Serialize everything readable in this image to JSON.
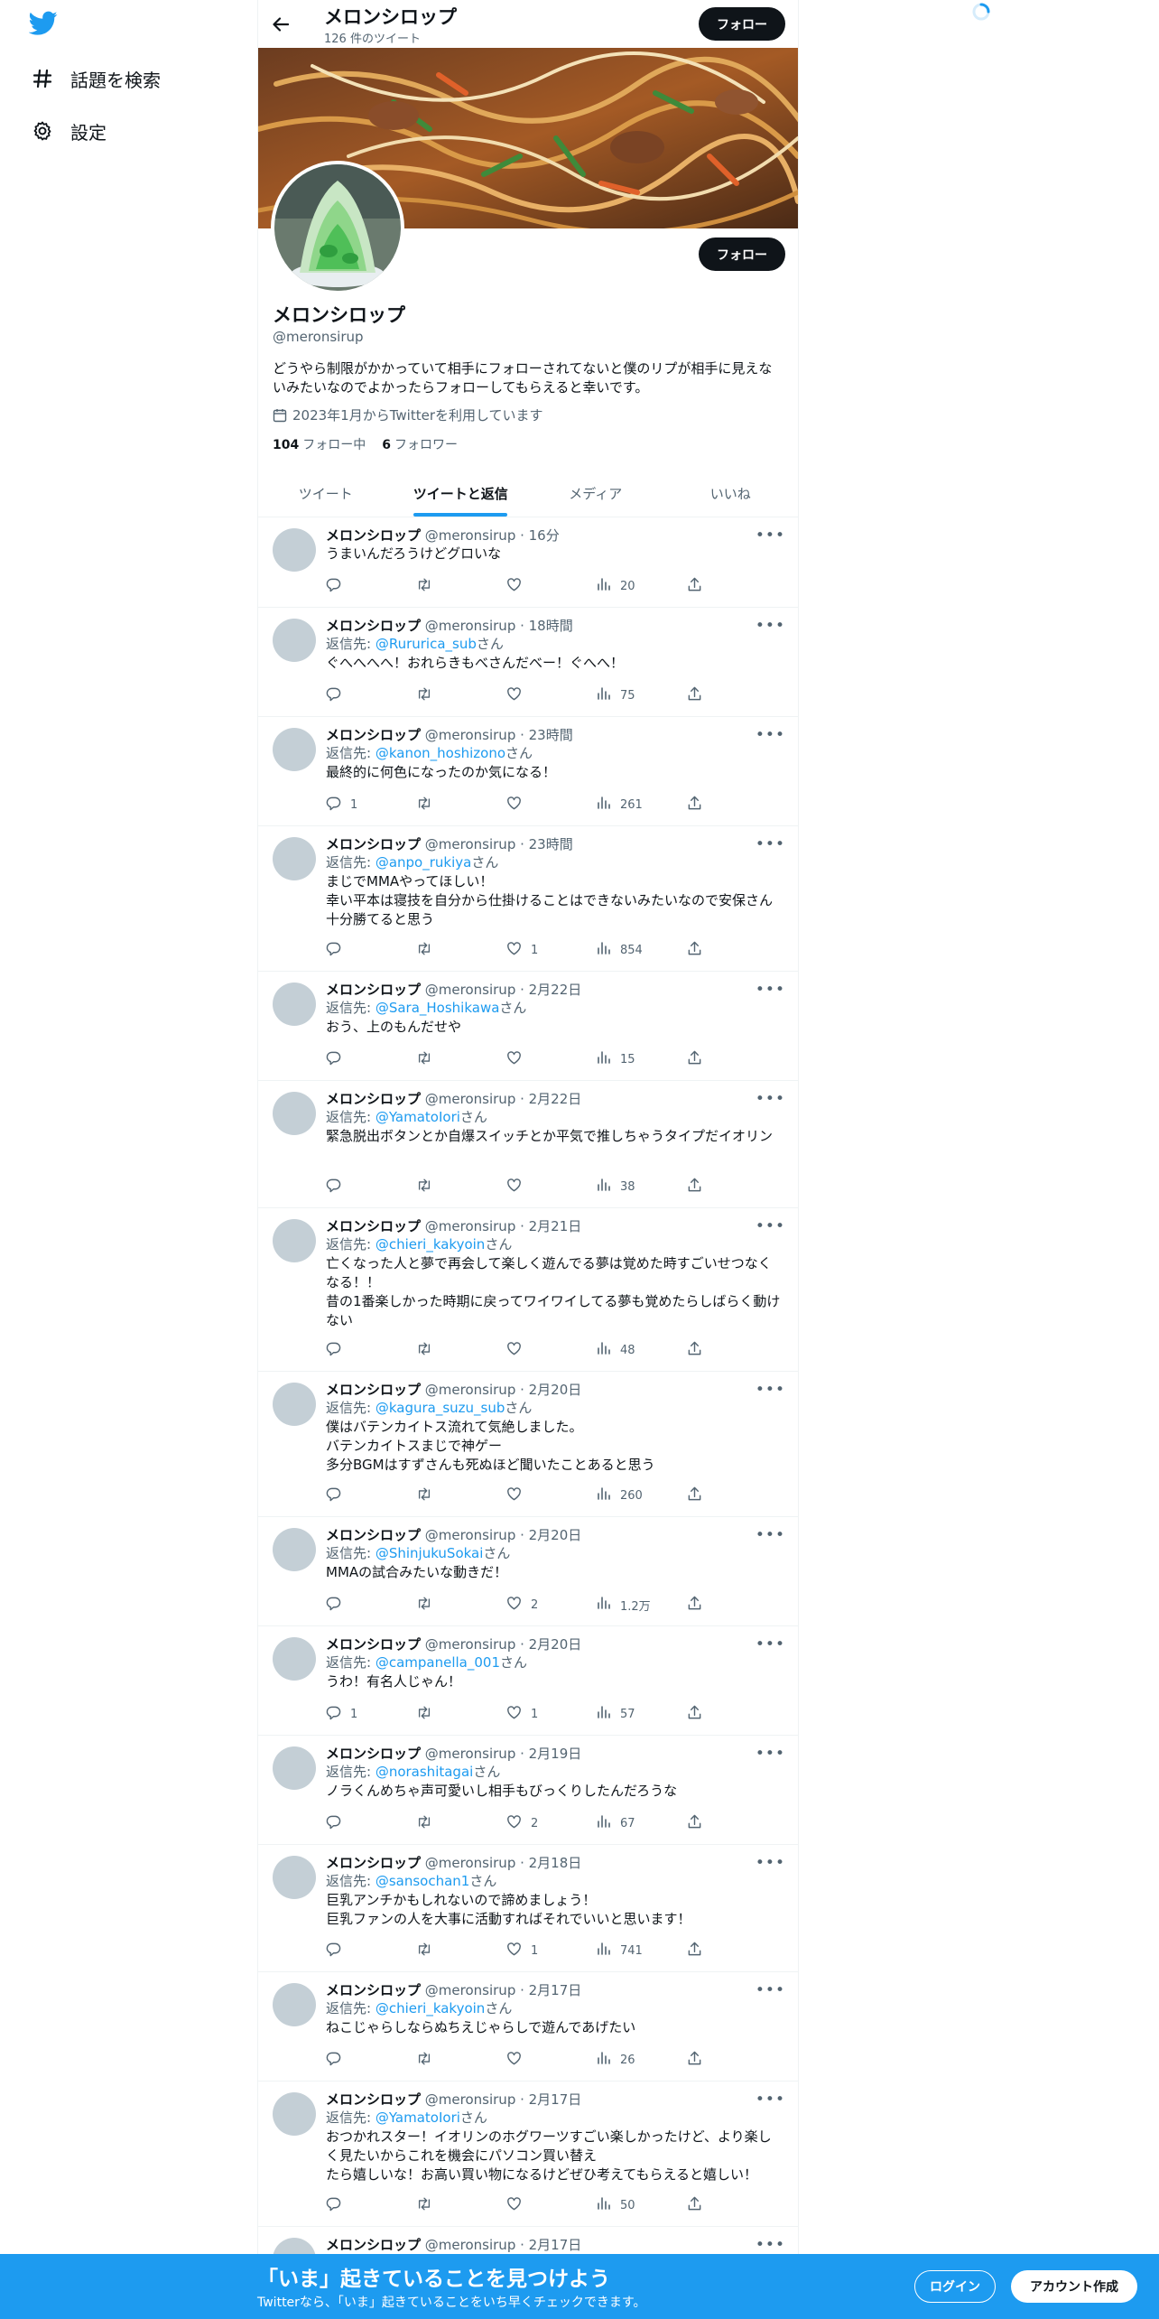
{
  "nav": {
    "explore_label": "話題を検索",
    "settings_label": "設定"
  },
  "header": {
    "name": "メロンシロップ",
    "tweet_count": "126 件のツイート",
    "follow_label": "フォロー"
  },
  "profile": {
    "name": "メロンシロップ",
    "handle": "@meronsirup",
    "bio": "どうやら制限がかかっていて相手にフォローされてないと僕のリプが相手に見えないみたいなのでよかったらフォローしてもらえると幸いです。",
    "joined": "2023年1月からTwitterを利用しています",
    "following_count": "104",
    "following_label": "フォロー中",
    "followers_count": "6",
    "followers_label": "フォロワー",
    "follow_label": "フォロー"
  },
  "tabs": [
    "ツイート",
    "ツイートと返信",
    "メディア",
    "いいね"
  ],
  "active_tab": 1,
  "tweets": [
    {
      "name": "メロンシロップ",
      "meta": "@meronsirup · 16分",
      "reply_to": "",
      "text": "うまいんだろうけどグロいな",
      "replies": "",
      "likes": "",
      "views": "20",
      "height": 100
    },
    {
      "name": "メロンシロップ",
      "meta": "@meronsirup · 18時間",
      "reply_to": "@Rururica_sub",
      "text": "ぐへへへへ！おれらきもべさんだべー！ぐへへ！",
      "replies": "",
      "likes": "",
      "views": "75",
      "height": 121
    },
    {
      "name": "メロンシロップ",
      "meta": "@meronsirup · 23時間",
      "reply_to": "@kanon_hoshizono",
      "text": "最終的に何色になったのか気になる！",
      "replies": "1",
      "likes": "",
      "views": "261",
      "height": 121
    },
    {
      "name": "メロンシロップ",
      "meta": "@meronsirup · 23時間",
      "reply_to": "@anpo_rukiya",
      "text": "まじでMMAやってほしい！\n幸い平本は寝技を自分から仕掛けることはできないみたいなので安保さん十分勝てると思う",
      "replies": "",
      "likes": "1",
      "views": "854",
      "height": 161
    },
    {
      "name": "メロンシロップ",
      "meta": "@meronsirup · 2月22日",
      "reply_to": "@Sara_Hoshikawa",
      "text": "おう、上のもんだせや",
      "replies": "",
      "likes": "",
      "views": "15",
      "height": 121
    },
    {
      "name": "メロンシロップ",
      "meta": "@meronsirup · 2月22日",
      "reply_to": "@YamatoIori",
      "text": "緊急脱出ボタンとか自爆スイッチとか平気で推しちゃうタイプだイオリン",
      "replies": "",
      "likes": "",
      "views": "38",
      "height": 141
    },
    {
      "name": "メロンシロップ",
      "meta": "@meronsirup · 2月21日",
      "reply_to": "@chieri_kakyoin",
      "text": "亡くなった人と夢で再会して楽しく遊んでる夢は覚めた時すごいせつなくなる！！\n昔の1番楽しかった時期に戻ってワイワイしてる夢も覚めたらしばらく動けない",
      "replies": "",
      "likes": "",
      "views": "48",
      "height": 181
    },
    {
      "name": "メロンシロップ",
      "meta": "@meronsirup · 2月20日",
      "reply_to": "@kagura_suzu_sub",
      "text": "僕はバテンカイトス流れて気絶しました。\nバテンカイトスまじで神ゲー\n多分BGMはすずさんも死ぬほど聞いたことあると思う",
      "replies": "",
      "likes": "",
      "views": "260",
      "height": 161
    },
    {
      "name": "メロンシロップ",
      "meta": "@meronsirup · 2月20日",
      "reply_to": "@ShinjukuSokai",
      "text": "MMAの試合みたいな動きだ！",
      "replies": "",
      "likes": "2",
      "views": "1.2万",
      "height": 121
    },
    {
      "name": "メロンシロップ",
      "meta": "@meronsirup · 2月20日",
      "reply_to": "@campanella_001",
      "text": "うわ！有名人じゃん！",
      "replies": "1",
      "likes": "1",
      "views": "57",
      "height": 121
    },
    {
      "name": "メロンシロップ",
      "meta": "@meronsirup · 2月19日",
      "reply_to": "@norashitagai",
      "text": "ノラくんめちゃ声可愛いし相手もびっくりしたんだろうな",
      "replies": "",
      "likes": "2",
      "views": "67",
      "height": 121
    },
    {
      "name": "メロンシロップ",
      "meta": "@meronsirup · 2月18日",
      "reply_to": "@sansochan1",
      "text": "巨乳アンチかもしれないので諦めましょう！\n巨乳ファンの人を大事に活動すればそれでいいと思います！",
      "replies": "",
      "likes": "1",
      "views": "741",
      "height": 141
    },
    {
      "name": "メロンシロップ",
      "meta": "@meronsirup · 2月17日",
      "reply_to": "@chieri_kakyoin",
      "text": "ねこじゃらしならぬちえじゃらしで遊んであげたい",
      "replies": "",
      "likes": "",
      "views": "26",
      "height": 121
    },
    {
      "name": "メロンシロップ",
      "meta": "@meronsirup · 2月17日",
      "reply_to": "@YamatoIori",
      "text": "おつかれスター！イオリンのホグワーツすごい楽しかったけど、より楽しく見たいからこれを機会にパソコン買い替え\nたら嬉しいな！お高い買い物になるけどぜひ考えてもらえると嬉しい！",
      "replies": "",
      "likes": "",
      "views": "50",
      "height": 161
    },
    {
      "name": "メロンシロップ",
      "meta": "@meronsirup · 2月17日",
      "reply_to": "",
      "text": "",
      "replies": "",
      "likes": "",
      "views": "",
      "height": 60
    }
  ],
  "reply_prefix": "返信先: ",
  "reply_suffix": "さん",
  "bottom_bar": {
    "title": "「いま」起きていることを見つけよう",
    "subtitle": "Twitterなら、「いま」起きていることをいち早くチェックできます。",
    "login_label": "ログイン",
    "signup_label": "アカウント作成"
  },
  "colors": {
    "accent": "#1d9bf0",
    "text": "#0f1419",
    "muted": "#536471",
    "button_dark": "#0f1419"
  }
}
